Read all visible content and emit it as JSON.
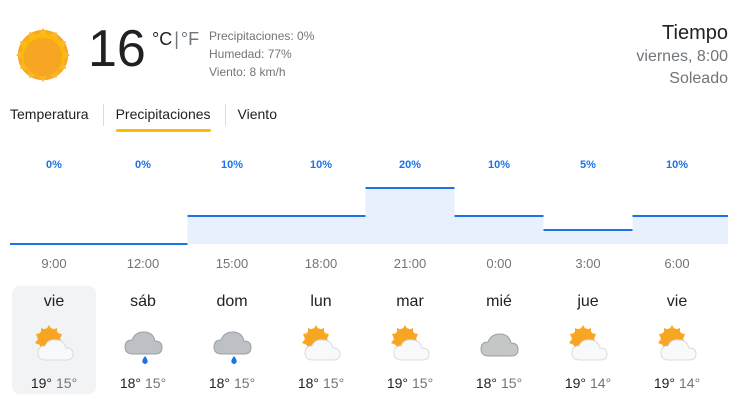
{
  "current": {
    "temperature": "16",
    "unit_c": "°C",
    "unit_sep": "|",
    "unit_f": "°F",
    "precipitation": "Precipitaciones: 0%",
    "humidity": "Humedad: 77%",
    "wind": "Viento: 8 km/h",
    "icon": "sun-icon"
  },
  "header": {
    "title": "Tiempo",
    "datetime": "viernes, 8:00",
    "condition": "Soleado"
  },
  "tabs": [
    {
      "label": "Temperatura",
      "active": false
    },
    {
      "label": "Precipitaciones",
      "active": true
    },
    {
      "label": "Viento",
      "active": false
    }
  ],
  "chart_data": {
    "type": "area",
    "unit": "%",
    "x": [
      "9:00",
      "12:00",
      "15:00",
      "18:00",
      "21:00",
      "0:00",
      "3:00",
      "6:00"
    ],
    "values": [
      0,
      0,
      10,
      10,
      20,
      10,
      5,
      10
    ],
    "labels": [
      "0%",
      "0%",
      "10%",
      "10%",
      "20%",
      "10%",
      "5%",
      "10%"
    ],
    "ylim": [
      0,
      100
    ],
    "colors": {
      "line": "#1a73e8",
      "fill": "#e8f0fe",
      "label": "#1a73e8"
    }
  },
  "days": [
    {
      "name": "vie",
      "icon": "partly-cloudy-icon",
      "hi": "19°",
      "lo": "15°",
      "selected": true
    },
    {
      "name": "sáb",
      "icon": "rain-cloud-icon",
      "hi": "18°",
      "lo": "15°",
      "selected": false
    },
    {
      "name": "dom",
      "icon": "rain-cloud-icon",
      "hi": "18°",
      "lo": "15°",
      "selected": false
    },
    {
      "name": "lun",
      "icon": "partly-cloudy-icon",
      "hi": "18°",
      "lo": "15°",
      "selected": false
    },
    {
      "name": "mar",
      "icon": "partly-cloudy-icon",
      "hi": "19°",
      "lo": "15°",
      "selected": false
    },
    {
      "name": "mié",
      "icon": "cloud-icon",
      "hi": "18°",
      "lo": "15°",
      "selected": false
    },
    {
      "name": "jue",
      "icon": "partly-cloudy-icon",
      "hi": "19°",
      "lo": "14°",
      "selected": false
    },
    {
      "name": "vie",
      "icon": "partly-cloudy-icon",
      "hi": "19°",
      "lo": "14°",
      "selected": false
    }
  ]
}
